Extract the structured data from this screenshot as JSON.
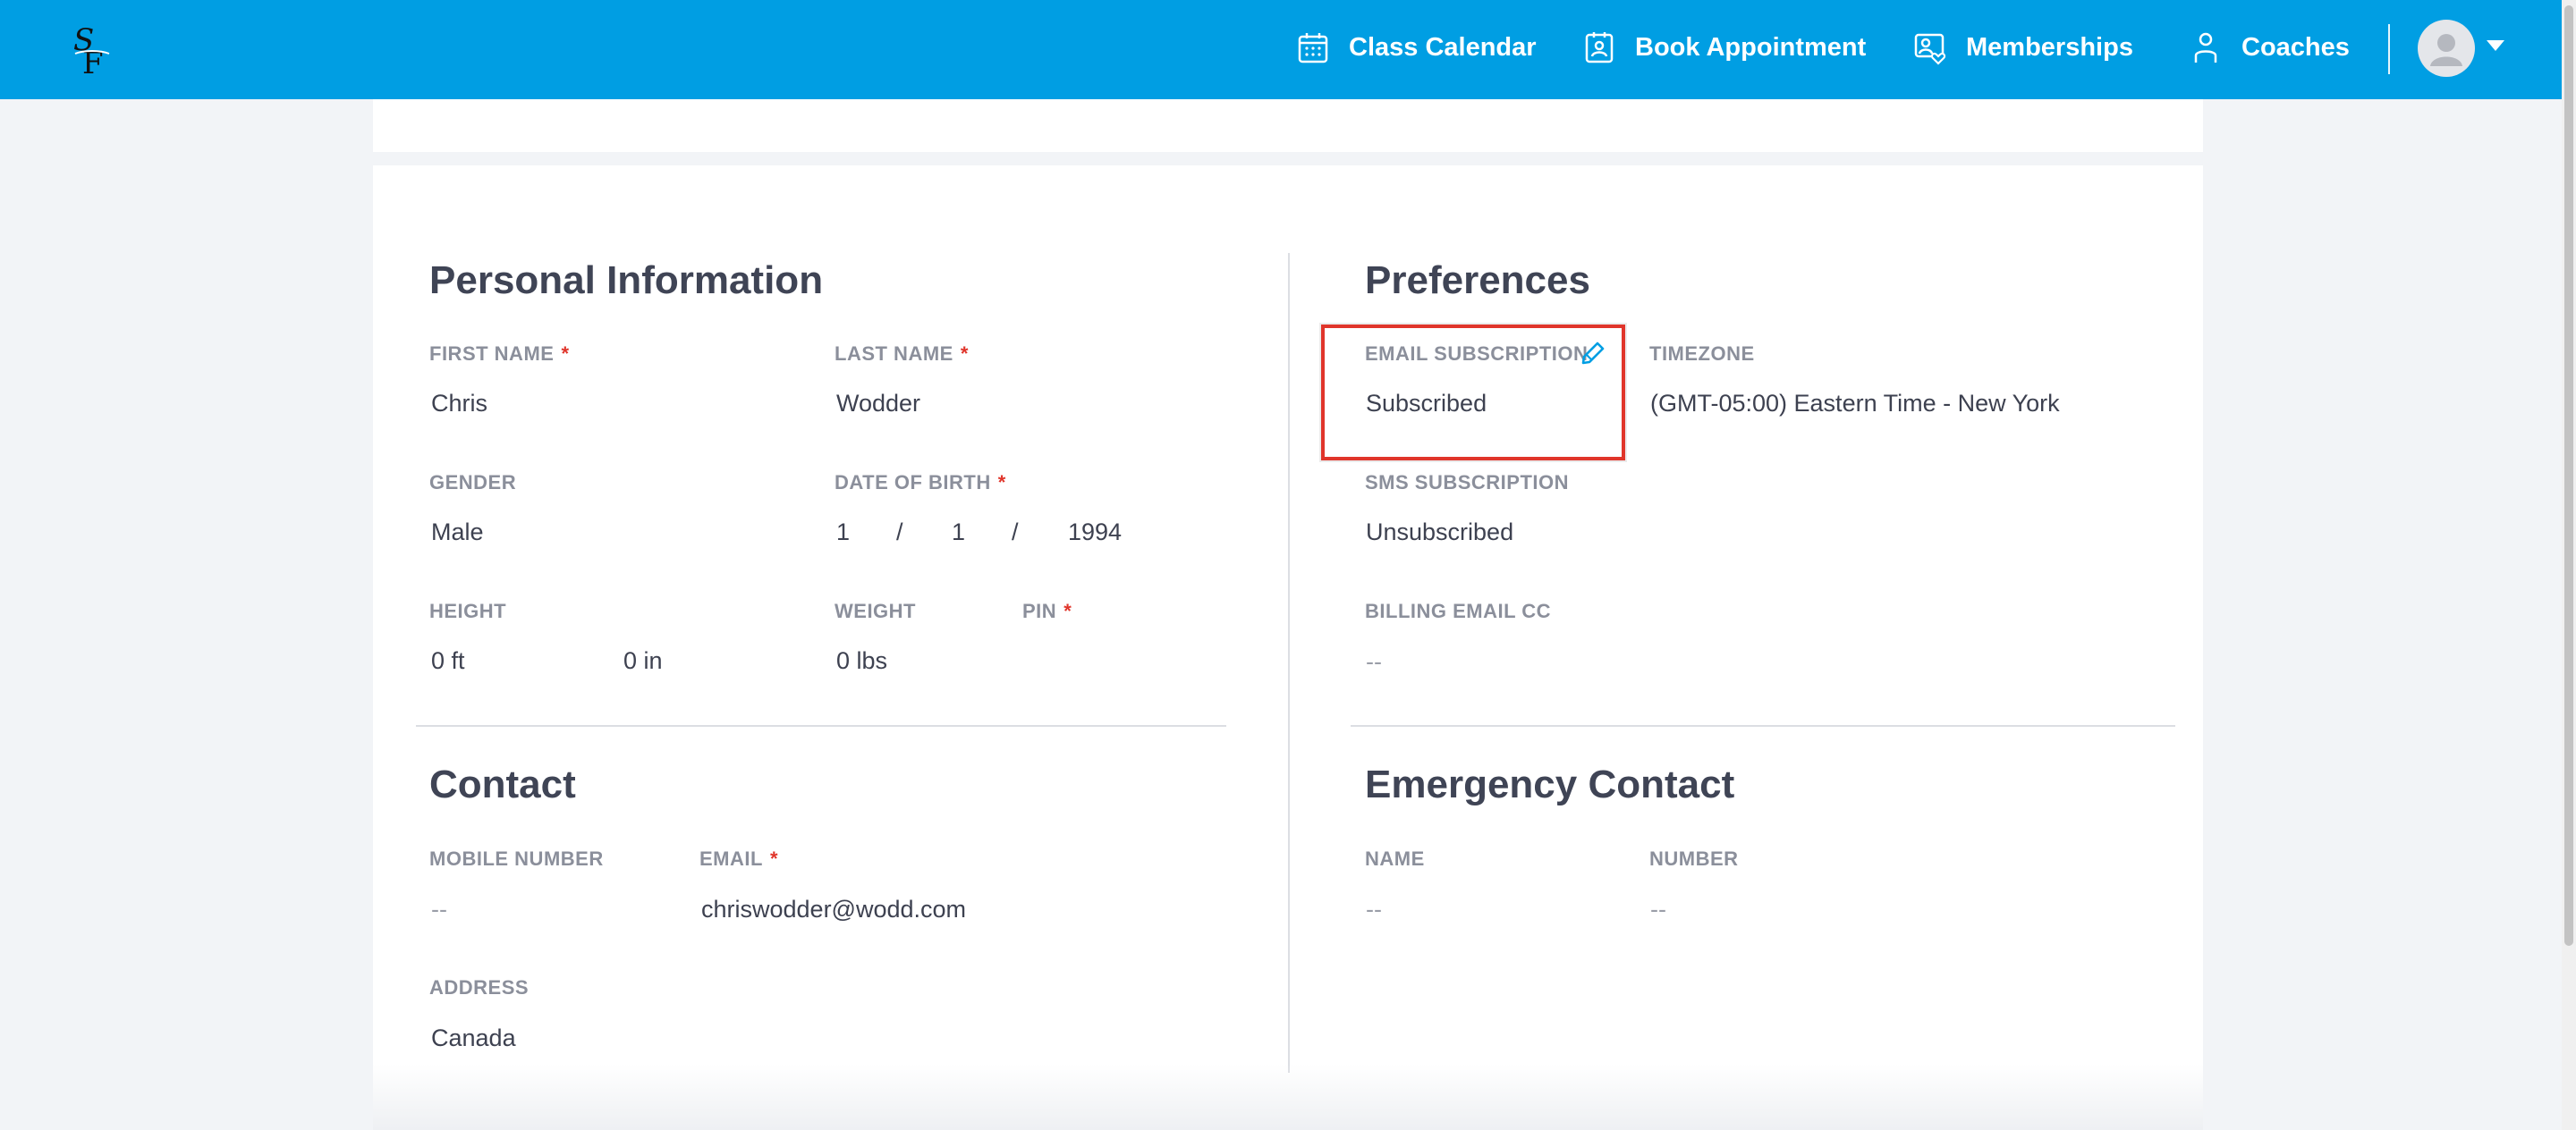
{
  "nav": {
    "items": [
      {
        "label": "Class Calendar",
        "icon": "calendar-icon"
      },
      {
        "label": "Book Appointment",
        "icon": "appointment-icon"
      },
      {
        "label": "Memberships",
        "icon": "membership-icon"
      },
      {
        "label": "Coaches",
        "icon": "person-icon"
      }
    ],
    "accent": "#009ee3"
  },
  "personal": {
    "title": "Personal Information",
    "first_name": {
      "label": "FIRST NAME",
      "required": "*",
      "value": "Chris"
    },
    "last_name": {
      "label": "LAST NAME",
      "required": "*",
      "value": "Wodder"
    },
    "gender": {
      "label": "GENDER",
      "value": "Male"
    },
    "dob": {
      "label": "DATE OF BIRTH",
      "required": "*",
      "month": "1",
      "sep": "/",
      "day": "1",
      "year": "1994"
    },
    "height": {
      "label": "HEIGHT",
      "ft": "0 ft",
      "in": "0 in"
    },
    "weight": {
      "label": "WEIGHT",
      "value": "0 lbs"
    },
    "pin": {
      "label": "PIN",
      "required": "*"
    }
  },
  "contact": {
    "title": "Contact",
    "mobile": {
      "label": "MOBILE NUMBER",
      "value": "--"
    },
    "email": {
      "label": "EMAIL",
      "required": "*",
      "value": "chriswodder@wodd.com"
    },
    "address": {
      "label": "ADDRESS",
      "value": "Canada"
    }
  },
  "preferences": {
    "title": "Preferences",
    "email_subscription": {
      "label": "EMAIL SUBSCRIPTION",
      "value": "Subscribed"
    },
    "timezone": {
      "label": "TIMEZONE",
      "value": "(GMT-05:00) Eastern Time - New York"
    },
    "sms_subscription": {
      "label": "SMS SUBSCRIPTION",
      "value": "Unsubscribed"
    },
    "billing_email_cc": {
      "label": "BILLING EMAIL CC",
      "value": "--"
    }
  },
  "emergency": {
    "title": "Emergency Contact",
    "name": {
      "label": "NAME",
      "value": "--"
    },
    "number": {
      "label": "NUMBER",
      "value": "--"
    }
  }
}
